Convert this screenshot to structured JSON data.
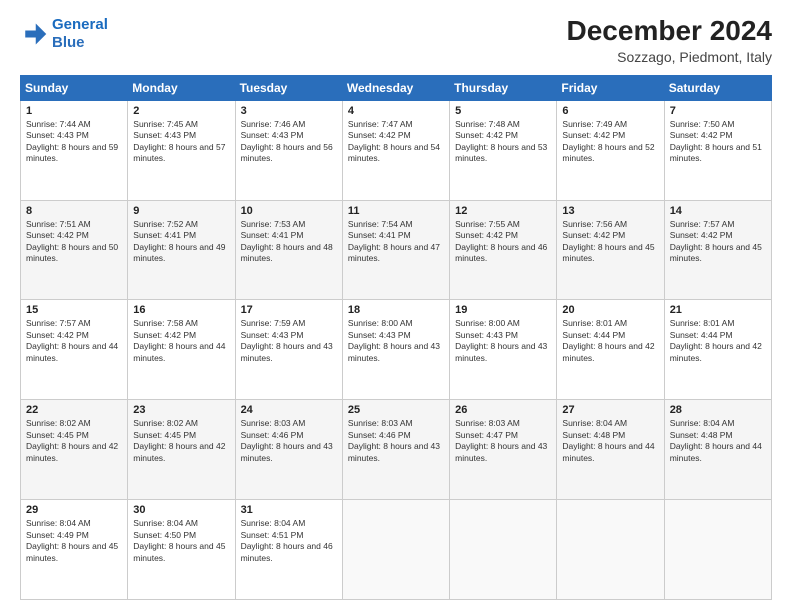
{
  "header": {
    "logo_line1": "General",
    "logo_line2": "Blue",
    "main_title": "December 2024",
    "subtitle": "Sozzago, Piedmont, Italy"
  },
  "calendar": {
    "days_of_week": [
      "Sunday",
      "Monday",
      "Tuesday",
      "Wednesday",
      "Thursday",
      "Friday",
      "Saturday"
    ],
    "weeks": [
      [
        {
          "day": "1",
          "sunrise": "7:44 AM",
          "sunset": "4:43 PM",
          "daylight": "8 hours and 59 minutes."
        },
        {
          "day": "2",
          "sunrise": "7:45 AM",
          "sunset": "4:43 PM",
          "daylight": "8 hours and 57 minutes."
        },
        {
          "day": "3",
          "sunrise": "7:46 AM",
          "sunset": "4:43 PM",
          "daylight": "8 hours and 56 minutes."
        },
        {
          "day": "4",
          "sunrise": "7:47 AM",
          "sunset": "4:42 PM",
          "daylight": "8 hours and 54 minutes."
        },
        {
          "day": "5",
          "sunrise": "7:48 AM",
          "sunset": "4:42 PM",
          "daylight": "8 hours and 53 minutes."
        },
        {
          "day": "6",
          "sunrise": "7:49 AM",
          "sunset": "4:42 PM",
          "daylight": "8 hours and 52 minutes."
        },
        {
          "day": "7",
          "sunrise": "7:50 AM",
          "sunset": "4:42 PM",
          "daylight": "8 hours and 51 minutes."
        }
      ],
      [
        {
          "day": "8",
          "sunrise": "7:51 AM",
          "sunset": "4:42 PM",
          "daylight": "8 hours and 50 minutes."
        },
        {
          "day": "9",
          "sunrise": "7:52 AM",
          "sunset": "4:41 PM",
          "daylight": "8 hours and 49 minutes."
        },
        {
          "day": "10",
          "sunrise": "7:53 AM",
          "sunset": "4:41 PM",
          "daylight": "8 hours and 48 minutes."
        },
        {
          "day": "11",
          "sunrise": "7:54 AM",
          "sunset": "4:41 PM",
          "daylight": "8 hours and 47 minutes."
        },
        {
          "day": "12",
          "sunrise": "7:55 AM",
          "sunset": "4:42 PM",
          "daylight": "8 hours and 46 minutes."
        },
        {
          "day": "13",
          "sunrise": "7:56 AM",
          "sunset": "4:42 PM",
          "daylight": "8 hours and 45 minutes."
        },
        {
          "day": "14",
          "sunrise": "7:57 AM",
          "sunset": "4:42 PM",
          "daylight": "8 hours and 45 minutes."
        }
      ],
      [
        {
          "day": "15",
          "sunrise": "7:57 AM",
          "sunset": "4:42 PM",
          "daylight": "8 hours and 44 minutes."
        },
        {
          "day": "16",
          "sunrise": "7:58 AM",
          "sunset": "4:42 PM",
          "daylight": "8 hours and 44 minutes."
        },
        {
          "day": "17",
          "sunrise": "7:59 AM",
          "sunset": "4:43 PM",
          "daylight": "8 hours and 43 minutes."
        },
        {
          "day": "18",
          "sunrise": "8:00 AM",
          "sunset": "4:43 PM",
          "daylight": "8 hours and 43 minutes."
        },
        {
          "day": "19",
          "sunrise": "8:00 AM",
          "sunset": "4:43 PM",
          "daylight": "8 hours and 43 minutes."
        },
        {
          "day": "20",
          "sunrise": "8:01 AM",
          "sunset": "4:44 PM",
          "daylight": "8 hours and 42 minutes."
        },
        {
          "day": "21",
          "sunrise": "8:01 AM",
          "sunset": "4:44 PM",
          "daylight": "8 hours and 42 minutes."
        }
      ],
      [
        {
          "day": "22",
          "sunrise": "8:02 AM",
          "sunset": "4:45 PM",
          "daylight": "8 hours and 42 minutes."
        },
        {
          "day": "23",
          "sunrise": "8:02 AM",
          "sunset": "4:45 PM",
          "daylight": "8 hours and 42 minutes."
        },
        {
          "day": "24",
          "sunrise": "8:03 AM",
          "sunset": "4:46 PM",
          "daylight": "8 hours and 43 minutes."
        },
        {
          "day": "25",
          "sunrise": "8:03 AM",
          "sunset": "4:46 PM",
          "daylight": "8 hours and 43 minutes."
        },
        {
          "day": "26",
          "sunrise": "8:03 AM",
          "sunset": "4:47 PM",
          "daylight": "8 hours and 43 minutes."
        },
        {
          "day": "27",
          "sunrise": "8:04 AM",
          "sunset": "4:48 PM",
          "daylight": "8 hours and 44 minutes."
        },
        {
          "day": "28",
          "sunrise": "8:04 AM",
          "sunset": "4:48 PM",
          "daylight": "8 hours and 44 minutes."
        }
      ],
      [
        {
          "day": "29",
          "sunrise": "8:04 AM",
          "sunset": "4:49 PM",
          "daylight": "8 hours and 45 minutes."
        },
        {
          "day": "30",
          "sunrise": "8:04 AM",
          "sunset": "4:50 PM",
          "daylight": "8 hours and 45 minutes."
        },
        {
          "day": "31",
          "sunrise": "8:04 AM",
          "sunset": "4:51 PM",
          "daylight": "8 hours and 46 minutes."
        },
        null,
        null,
        null,
        null
      ]
    ]
  }
}
